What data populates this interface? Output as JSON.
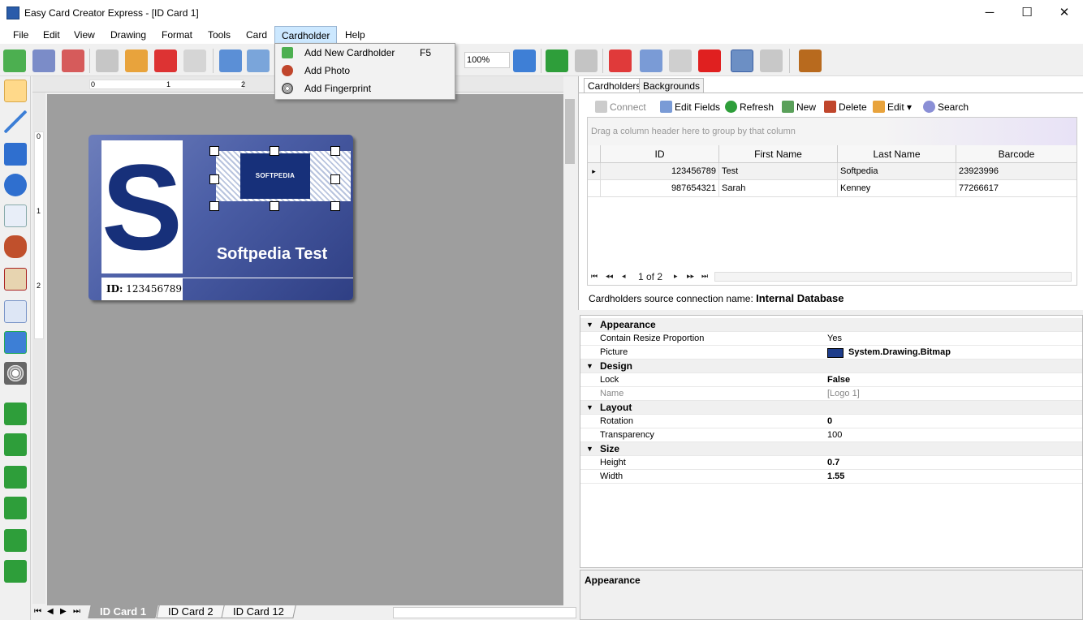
{
  "window": {
    "title": "Easy Card Creator Express - [ID Card 1]",
    "minimize": "─",
    "maximize": "☐",
    "close": "✕"
  },
  "menu": [
    "File",
    "Edit",
    "View",
    "Drawing",
    "Format",
    "Tools",
    "Card",
    "Cardholder",
    "Help"
  ],
  "dropdown": {
    "items": [
      {
        "label": "Add New Cardholder",
        "shortcut": "F5",
        "icon": "add-cardholder-icon"
      },
      {
        "label": "Add Photo",
        "shortcut": "",
        "icon": "person-icon"
      },
      {
        "label": "Add Fingerprint",
        "shortcut": "",
        "icon": "fingerprint-icon"
      }
    ]
  },
  "toolbar": {
    "zoom": "100%"
  },
  "ruler": {
    "h_labels": [
      "0",
      "1",
      "2"
    ],
    "v_labels": [
      "0",
      "1",
      "2"
    ]
  },
  "card": {
    "logo_letter": "S",
    "logo_text": "SOFTPEDIA",
    "name": "Softpedia Test",
    "id_label": "ID:",
    "id_value": "123456789"
  },
  "page_tabs": [
    "ID Card 1",
    "ID Card 2",
    "ID Card 12"
  ],
  "page_nav": [
    "⏮",
    "◀",
    "▶",
    "⏭"
  ],
  "right_tabs": [
    "Cardholders",
    "Backgrounds"
  ],
  "db_toolbar": {
    "connect": "Connect",
    "edit_fields": "Edit Fields",
    "refresh": "Refresh",
    "new": "New",
    "delete": "Delete",
    "edit": "Edit ▾",
    "search": "Search"
  },
  "grid": {
    "group_hint": "Drag a column header here to group by that column",
    "columns": [
      "ID",
      "First Name",
      "Last Name",
      "Barcode"
    ],
    "rows": [
      [
        "123456789",
        "Test",
        "Softpedia",
        "23923996"
      ],
      [
        "987654321",
        "Sarah",
        "Kenney",
        "77266617"
      ]
    ],
    "row_indicator": "▸",
    "pager": "1 of 2",
    "nav_first": "⏮",
    "nav_prev_page": "◂◂",
    "nav_prev": "◂",
    "nav_next": "▸",
    "nav_next_page": "▸▸",
    "nav_last": "⏭"
  },
  "connection": {
    "label": "Cardholders source connection name:",
    "value": "Internal Database"
  },
  "properties": [
    {
      "type": "cat",
      "name": "Appearance"
    },
    {
      "type": "prop",
      "name": "Contain Resize Proportion",
      "value": "Yes",
      "bold": false
    },
    {
      "type": "prop",
      "name": "Picture",
      "value": "System.Drawing.Bitmap",
      "bold": true,
      "swatch": true
    },
    {
      "type": "cat",
      "name": "Design"
    },
    {
      "type": "prop",
      "name": "Lock",
      "value": "False",
      "bold": true
    },
    {
      "type": "prop",
      "name": "Name",
      "value": "[Logo 1]",
      "bold": false,
      "grey": true
    },
    {
      "type": "cat",
      "name": "Layout"
    },
    {
      "type": "prop",
      "name": "Rotation",
      "value": "0",
      "bold": true
    },
    {
      "type": "prop",
      "name": "Transparency",
      "value": "100",
      "bold": false
    },
    {
      "type": "cat",
      "name": "Size"
    },
    {
      "type": "prop",
      "name": "Height",
      "value": "0.7",
      "bold": true
    },
    {
      "type": "prop",
      "name": "Width",
      "value": "1.55",
      "bold": true
    }
  ],
  "description": {
    "title": "Appearance"
  },
  "colors": {
    "accent": "#cce8ff",
    "card_dark": "#2f3f84",
    "card_light": "#6d7ebb",
    "logo_blue": "#17307a"
  }
}
